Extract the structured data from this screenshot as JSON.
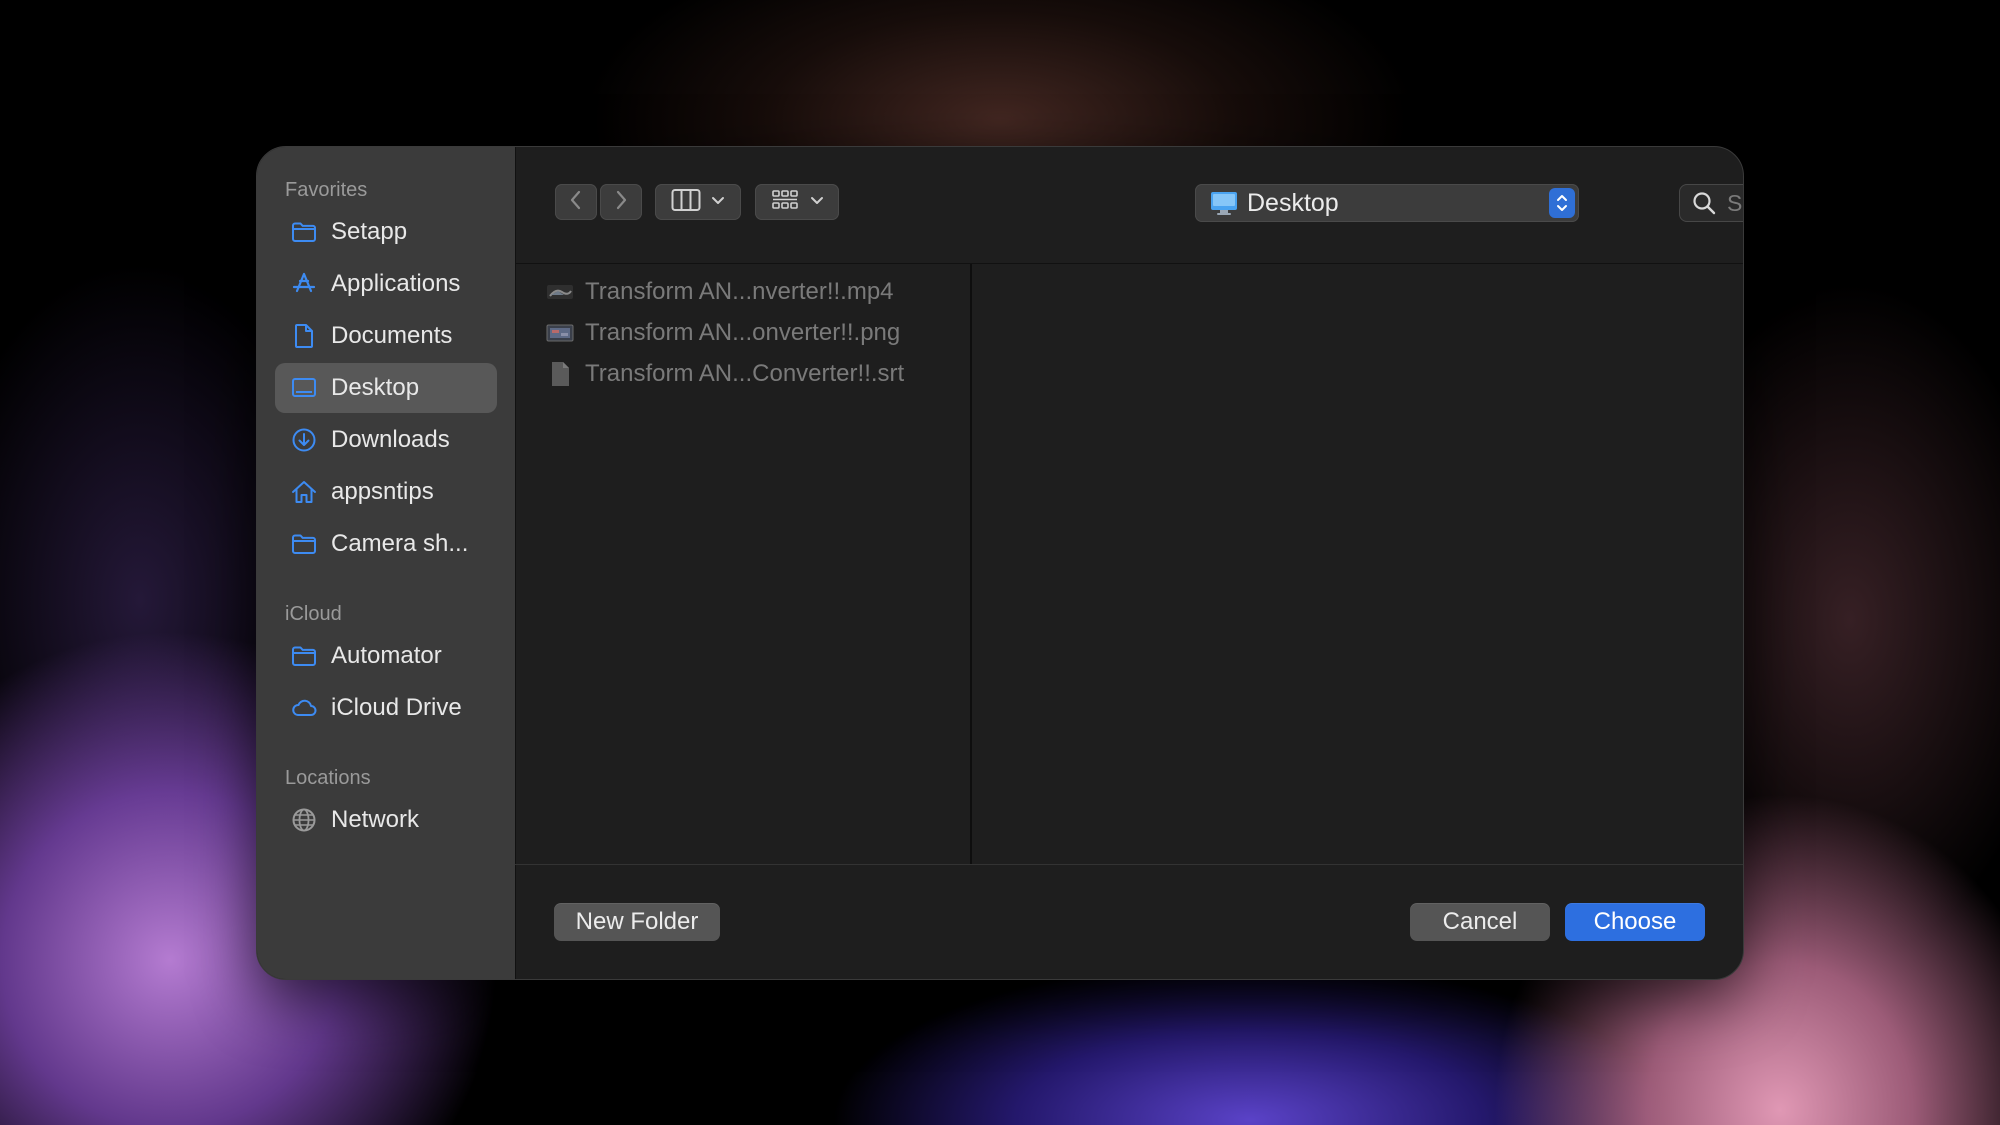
{
  "sidebar": {
    "sections": [
      {
        "title": "Favorites",
        "items": [
          {
            "label": "Setapp",
            "icon": "folder-icon"
          },
          {
            "label": "Applications",
            "icon": "applications-icon"
          },
          {
            "label": "Documents",
            "icon": "document-icon"
          },
          {
            "label": "Desktop",
            "icon": "desktop-icon",
            "selected": true
          },
          {
            "label": "Downloads",
            "icon": "downloads-icon"
          },
          {
            "label": "appsntips",
            "icon": "home-icon"
          },
          {
            "label": "Camera sh...",
            "icon": "folder-icon"
          }
        ]
      },
      {
        "title": "iCloud",
        "items": [
          {
            "label": "Automator",
            "icon": "folder-icon"
          },
          {
            "label": "iCloud Drive",
            "icon": "cloud-icon"
          }
        ]
      },
      {
        "title": "Locations",
        "items": [
          {
            "label": "Network",
            "icon": "globe-icon"
          }
        ]
      }
    ]
  },
  "toolbar": {
    "location": "Desktop",
    "search_placeholder": "Search"
  },
  "files": [
    {
      "name": "Transform AN...nverter!!.mp4",
      "icon": "video-file-icon"
    },
    {
      "name": "Transform AN...onverter!!.png",
      "icon": "image-file-icon"
    },
    {
      "name": "Transform AN...Converter!!.srt",
      "icon": "text-file-icon"
    }
  ],
  "footer": {
    "new_folder": "New Folder",
    "cancel": "Cancel",
    "choose": "Choose"
  },
  "colors": {
    "accent": "#2d6fe0",
    "sidebar_icon": "#3d8bf2"
  }
}
